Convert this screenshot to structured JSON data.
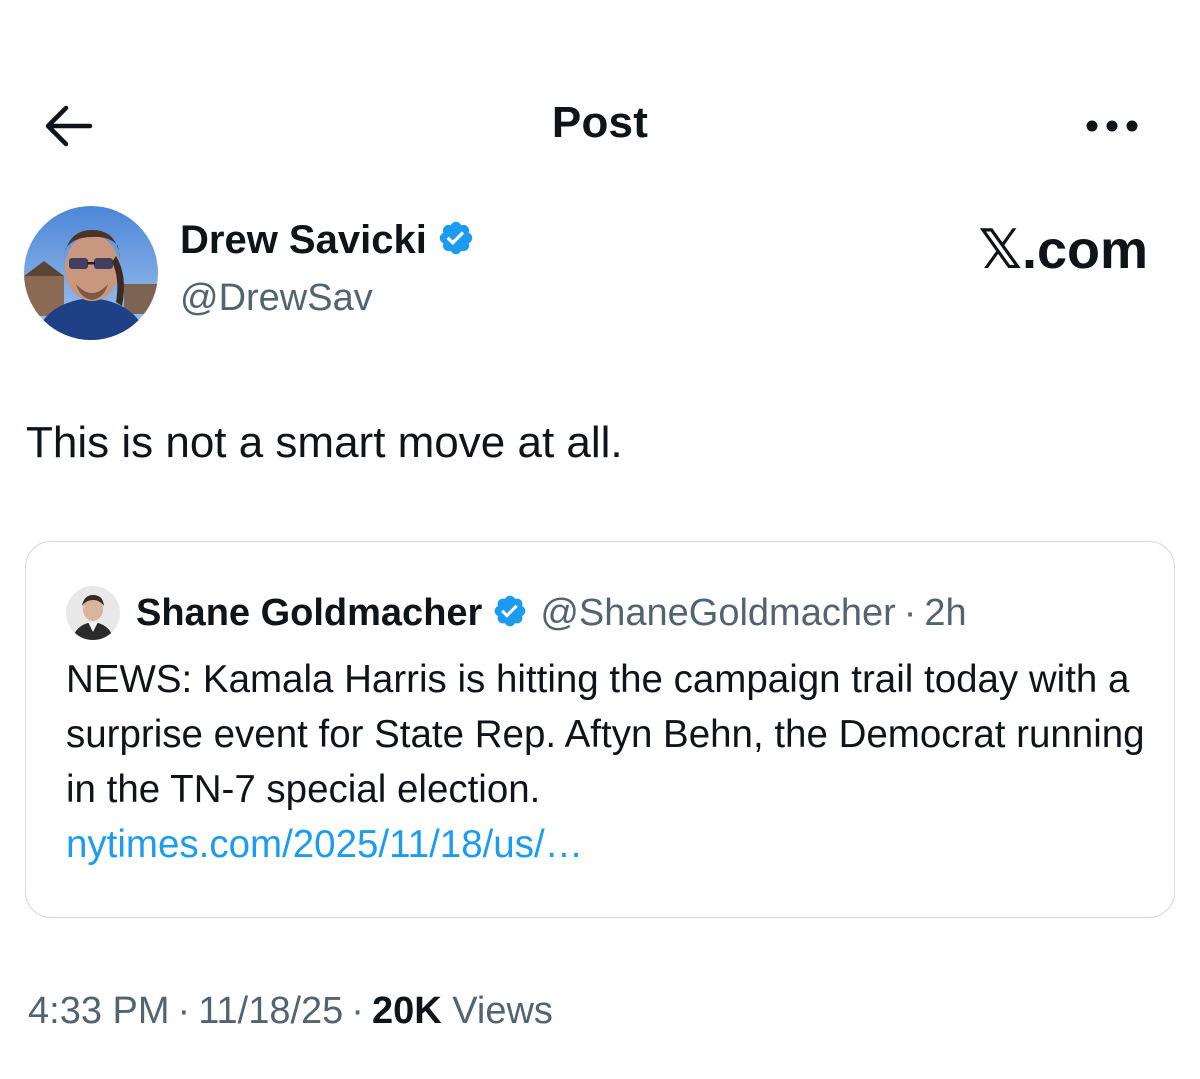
{
  "header": {
    "title": "Post"
  },
  "author": {
    "name": "Drew Savicki",
    "handle": "@DrewSav",
    "verified": true
  },
  "brand": "𝕏.com",
  "post": {
    "text": "This is not a smart move at all."
  },
  "quote": {
    "name": "Shane Goldmacher",
    "handle": "@ShaneGoldmacher",
    "separator": "·",
    "time": "2h",
    "text": "NEWS: Kamala Harris is hitting the campaign trail today with a surprise event for State Rep. Aftyn Behn, the Democrat running in the TN-7 special election.",
    "link": "nytimes.com/2025/11/18/us/…"
  },
  "meta": {
    "time": "4:33 PM",
    "separator": "·",
    "date": "11/18/25",
    "views_count": "20K",
    "views_label": "Views"
  },
  "colors": {
    "verified": "#1d9bf0",
    "link": "#1d9bf0",
    "secondary_text": "#536471"
  }
}
